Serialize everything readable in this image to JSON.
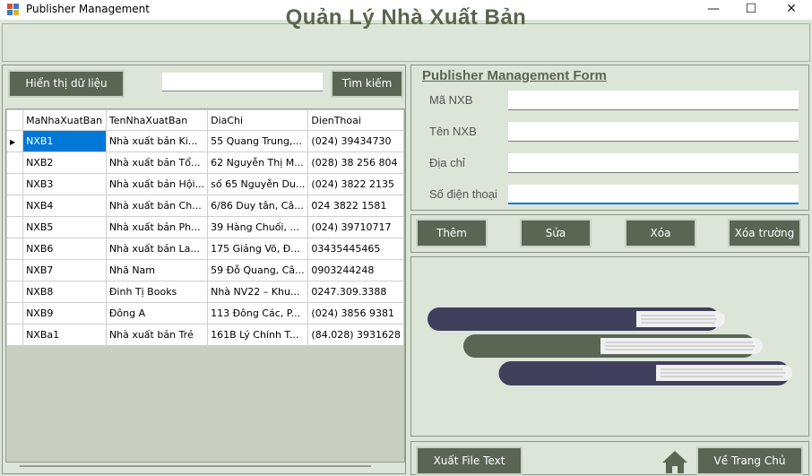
{
  "window": {
    "title": "Publisher Management",
    "minimize": "—",
    "maximize": "☐",
    "close": "✕"
  },
  "header": {
    "title": "Quản Lý  Nhà Xuất Bản"
  },
  "toolbar": {
    "show_data_label": "Hiển thị dữ liệu",
    "search_value": "",
    "search_label": "Tìm kiếm"
  },
  "grid": {
    "columns": [
      "MaNhaXuatBan",
      "TenNhaXuatBan",
      "DiaChi",
      "DienThoai"
    ],
    "rows": [
      [
        "NXB1",
        "Nhà xuất bản Ki...",
        "55 Quang Trung,...",
        "(024) 39434730"
      ],
      [
        "NXB2",
        "Nhà xuất bản Tổ...",
        "62 Nguyễn Thị M...",
        "(028) 38 256 804"
      ],
      [
        "NXB3",
        "Nhà xuất bản Hội...",
        "số 65 Nguyễn Du...",
        "(024) 3822 2135"
      ],
      [
        "NXB4",
        "Nhà xuất bản Ch...",
        "6/86 Duy tân, Câ...",
        "024 3822 1581"
      ],
      [
        "NXB5",
        "Nhà xuất bản Ph...",
        "39 Hàng Chuối, ...",
        "(024) 39710717"
      ],
      [
        "NXB6",
        "Nhà xuất bản La...",
        "175 Giảng Võ, Đ...",
        "03435445465"
      ],
      [
        "NXB7",
        "Nhã Nam",
        "59 Đỗ Quang, Câ...",
        "0903244248"
      ],
      [
        "NXB8",
        "Đinh Tị Books",
        "Nhà NV22 – Khu...",
        "0247.309.3388"
      ],
      [
        "NXB9",
        "Đông A",
        "113 Đông Các, P...",
        "(024) 3856 9381"
      ],
      [
        "NXBa1",
        "Nhà xuất bản Trẻ",
        "161B Lý Chính T...",
        "(84.028) 3931628"
      ]
    ],
    "selected_row": 0
  },
  "form": {
    "title": "Publisher Management Form",
    "fields": [
      {
        "label": "Mã NXB",
        "value": ""
      },
      {
        "label": "Tên NXB",
        "value": ""
      },
      {
        "label": "Địa chỉ",
        "value": ""
      },
      {
        "label": "Số điện thoại",
        "value": ""
      }
    ]
  },
  "actions": {
    "add": "Thêm",
    "edit": "Sửa",
    "delete": "Xóa",
    "clear": "Xóa trường"
  },
  "footer": {
    "export": "Xuất File Text",
    "home": "Về Trang Chủ"
  },
  "colors": {
    "background": "#dde4d8",
    "button": "#5a6653",
    "title_text": "#5a6550",
    "selection": "#0078d7",
    "book_dark": "#403f5c",
    "book_green": "#5a6653"
  },
  "icons": [
    "app-icon",
    "row-pointer-icon",
    "home-icon",
    "books-illustration"
  ]
}
